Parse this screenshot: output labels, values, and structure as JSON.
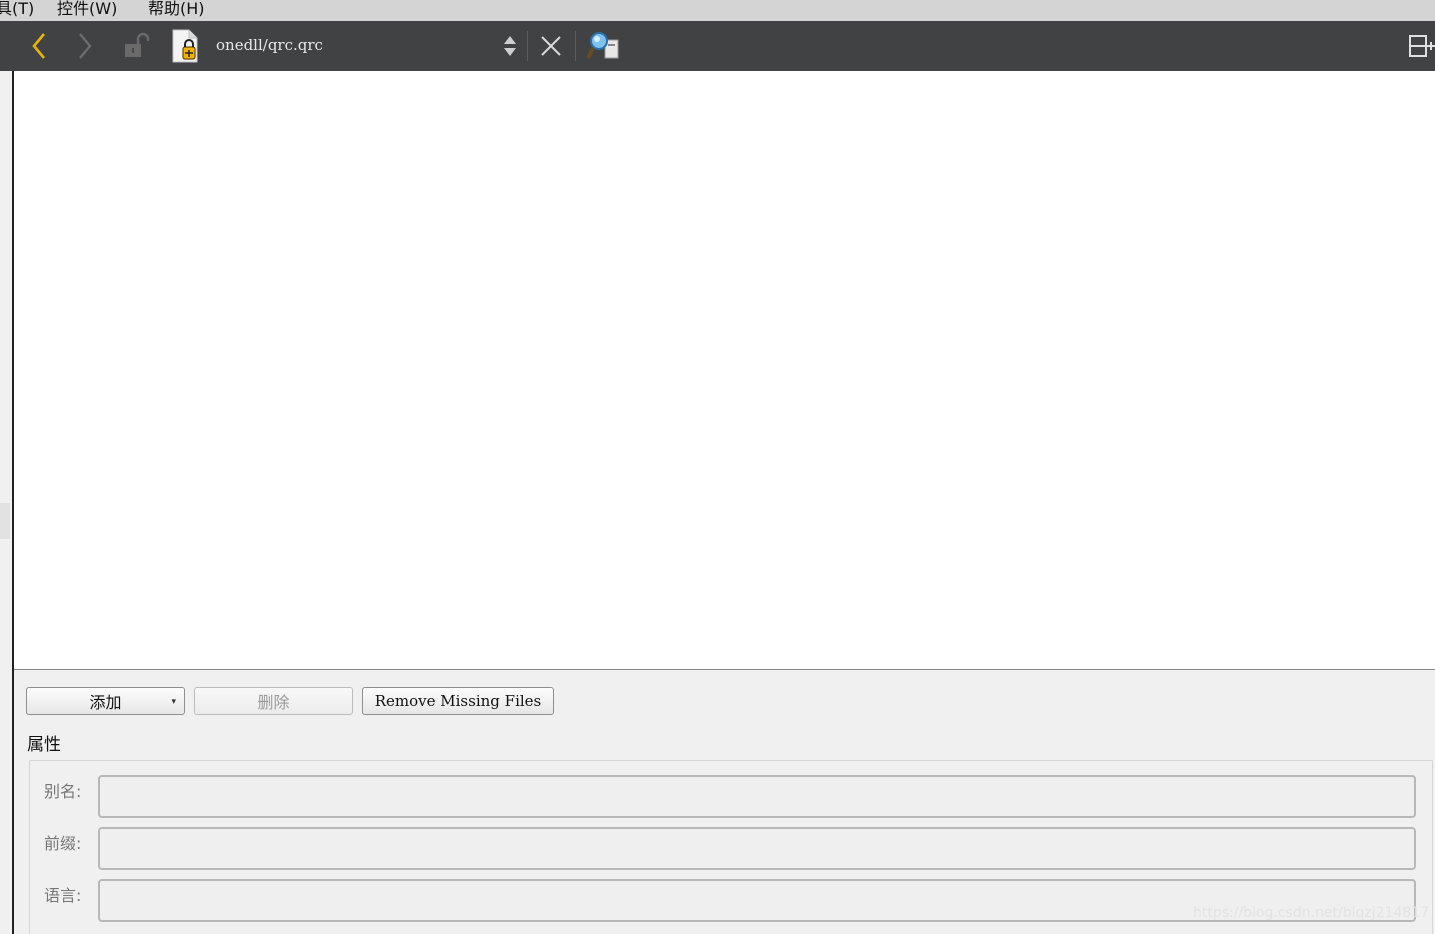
{
  "menubar": {
    "items": [
      {
        "label": "具(T)"
      },
      {
        "label": "控件(W)"
      },
      {
        "label": "帮助(H)"
      }
    ]
  },
  "toolbar": {
    "file_path": "onedll/qrc.qrc",
    "icons": [
      "back-arrow-icon",
      "forward-arrow-icon",
      "lock-icon",
      "qrc-file-icon",
      "sort-updown-icon",
      "close-icon",
      "find-icon",
      "split-add-icon"
    ]
  },
  "resources": {
    "add_label": "添加",
    "delete_label": "删除",
    "remove_missing_label": "Remove Missing Files",
    "properties_title": "属性",
    "fields": [
      {
        "label": "别名:",
        "value": ""
      },
      {
        "label": "前缀:",
        "value": ""
      },
      {
        "label": "语言:",
        "value": ""
      }
    ]
  },
  "watermark": "https://blog.csdn.net/blqzj214817",
  "colors": {
    "toolbar_bg": "#404244",
    "accent_yellow": "#e8b400",
    "tree_bg": "#ffffff",
    "panel_bg": "#f0f0f0"
  }
}
